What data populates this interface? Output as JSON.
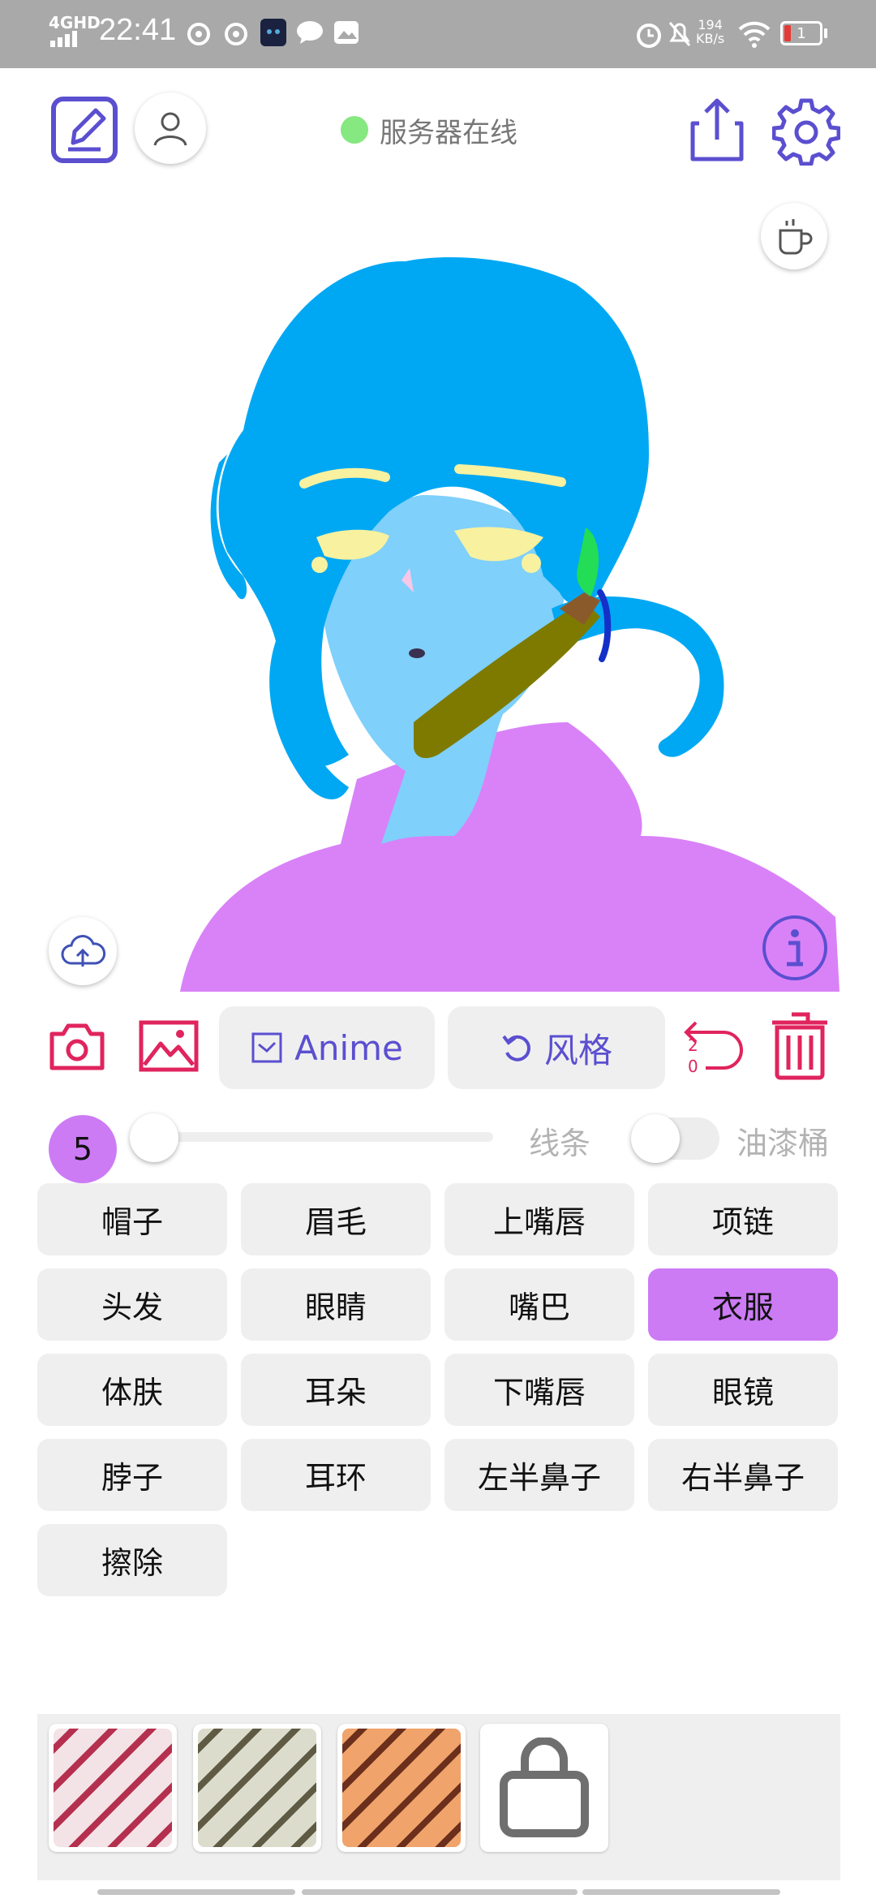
{
  "status_bar": {
    "network": "4GHD",
    "time": "22:41",
    "speed_value": "194",
    "speed_unit": "KB/s",
    "battery": "1"
  },
  "header": {
    "server_status": "服务器在线",
    "server_status_color": "#86e880",
    "accent": "#5b4fd0"
  },
  "toolbar": {
    "model_label": "Anime",
    "style_label": "风格",
    "undo_count_top": "2",
    "undo_count_bottom": "0",
    "icon_color": "#e0245e"
  },
  "brush": {
    "size": "5",
    "line_label": "线条",
    "bucket_label": "油漆桶",
    "accent": "#cc7bf5"
  },
  "parts": [
    {
      "label": "帽子",
      "selected": false
    },
    {
      "label": "眉毛",
      "selected": false
    },
    {
      "label": "上嘴唇",
      "selected": false
    },
    {
      "label": "项链",
      "selected": false
    },
    {
      "label": "头发",
      "selected": false
    },
    {
      "label": "眼睛",
      "selected": false
    },
    {
      "label": "嘴巴",
      "selected": false
    },
    {
      "label": "衣服",
      "selected": true
    },
    {
      "label": "体肤",
      "selected": false
    },
    {
      "label": "耳朵",
      "selected": false
    },
    {
      "label": "下嘴唇",
      "selected": false
    },
    {
      "label": "眼镜",
      "selected": false
    },
    {
      "label": "脖子",
      "selected": false
    },
    {
      "label": "耳环",
      "selected": false
    },
    {
      "label": "左半鼻子",
      "selected": false
    },
    {
      "label": "右半鼻子",
      "selected": false
    },
    {
      "label": "擦除",
      "selected": false
    }
  ],
  "styles": [
    {
      "name": "style-1",
      "colors": [
        "#f3e2e6",
        "#b5304f"
      ]
    },
    {
      "name": "style-2",
      "colors": [
        "#dcdccc",
        "#5e5a44"
      ]
    },
    {
      "name": "style-3",
      "colors": [
        "#f0a36a",
        "#6b2f1c"
      ]
    }
  ],
  "drawing_colors": {
    "hair": "#00a8f3",
    "skin": "#7fd0fb",
    "clothes": "#d982f8",
    "eyes": "#f7f1a0",
    "scarf": "#7e7a00",
    "accent_green": "#22dd55"
  }
}
